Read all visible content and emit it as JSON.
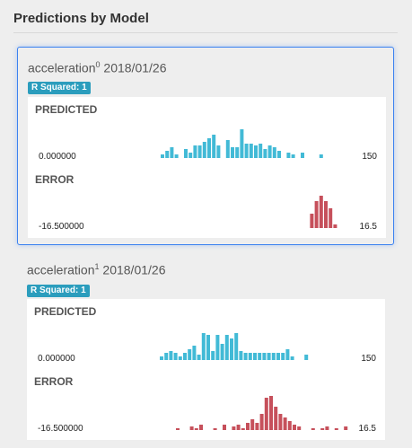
{
  "page": {
    "title": "Predictions by Model"
  },
  "models": [
    {
      "name": "acceleration",
      "index": "0",
      "date": "2018/01/26",
      "badge": "R Squared: 1",
      "selected": true,
      "predicted": {
        "label": "PREDICTED",
        "min": "0.000000",
        "max": "150",
        "color": "#42bad6"
      },
      "error": {
        "label": "ERROR",
        "min": "-16.500000",
        "max": "16.5",
        "color": "#c6505b"
      }
    },
    {
      "name": "acceleration",
      "index": "1",
      "date": "2018/01/26",
      "badge": "R Squared: 1",
      "selected": false,
      "predicted": {
        "label": "PREDICTED",
        "min": "0.000000",
        "max": "150",
        "color": "#42bad6"
      },
      "error": {
        "label": "ERROR",
        "min": "-16.500000",
        "max": "16.5",
        "color": "#c6505b"
      }
    }
  ],
  "chart_data": [
    {
      "type": "bar",
      "title": "PREDICTED",
      "xlim": [
        0,
        150
      ],
      "x": [
        0,
        3,
        6,
        9,
        12,
        15,
        18,
        21,
        24,
        27,
        30,
        33,
        36,
        39,
        42,
        45,
        48,
        51,
        54,
        57,
        60,
        63,
        66,
        69,
        72,
        75,
        78,
        81,
        84,
        87,
        90,
        93,
        96,
        99,
        102,
        105,
        108,
        111,
        114,
        117,
        120,
        123,
        126,
        129,
        132,
        135,
        138,
        141,
        144,
        147
      ],
      "values": [
        0,
        0,
        0,
        0,
        0,
        0,
        0,
        0,
        0,
        0,
        0,
        0,
        0,
        0,
        0,
        0,
        0,
        0,
        0,
        0,
        0,
        1,
        2,
        3,
        1,
        0,
        4,
        2,
        5,
        5,
        6,
        7,
        9,
        5,
        0,
        6,
        4,
        3,
        12,
        6,
        5,
        4,
        5,
        3,
        5,
        4,
        3,
        5,
        2,
        4,
        0,
        2,
        1,
        0,
        2,
        0,
        2,
        0,
        0,
        0,
        1
      ]
    }
  ]
}
